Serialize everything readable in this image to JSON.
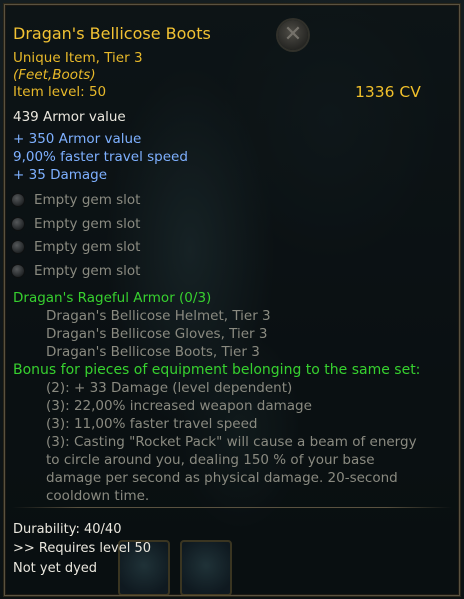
{
  "item": {
    "name": "Dragan's Bellicose Boots",
    "rarity": "Unique Item, Tier 3",
    "slot_type": "(Feet,Boots)",
    "item_level": "Item level: 50",
    "combat_value": "1336 CV",
    "base_stat": "439 Armor value"
  },
  "bonus_stats": [
    "+ 350 Armor value",
    "9,00% faster travel speed",
    "+ 35 Damage"
  ],
  "gem_slots": [
    "Empty gem slot",
    "Empty gem slot",
    "Empty gem slot",
    "Empty gem slot"
  ],
  "set": {
    "name": "Dragan's Rageful Armor (0/3)",
    "pieces": [
      "Dragan's Bellicose Helmet, Tier 3",
      "Dragan's Bellicose Gloves, Tier 3",
      "Dragan's Bellicose Boots, Tier 3"
    ],
    "bonus_header": "Bonus for pieces of equipment belonging to the same set:",
    "bonuses": [
      "(2): + 33 Damage (level dependent)",
      "(3): 22,00% increased weapon damage",
      "(3): 11,00% faster travel speed"
    ],
    "special_bonus_lines": [
      "(3): Casting \"Rocket Pack\" will cause a beam of energy",
      "to circle around you, dealing 150 % of your base",
      "damage per second as physical damage. 20-second",
      "cooldown time."
    ]
  },
  "footer": {
    "durability": "Durability: 40/40",
    "requirement": ">> Requires level 50",
    "dye_status": "Not yet dyed"
  },
  "icons": {
    "close": "close-icon",
    "gem": "gem-slot-icon"
  },
  "colors": {
    "title": "#f2c233",
    "bonus_stat": "#7eb0ff",
    "set_text": "#37d12f",
    "inactive": "#8a8a80"
  }
}
